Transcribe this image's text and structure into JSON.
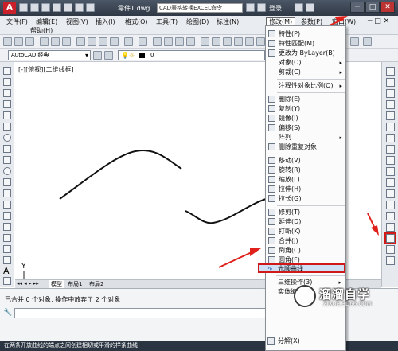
{
  "title_bar": {
    "doc_title": "零件1.dwg",
    "search_text": "CAD表格转换EXCEL命令",
    "user_label": "登录",
    "minimize": "─",
    "maximize": "□",
    "close": "✕"
  },
  "menu_bar": {
    "items": [
      "文件(F)",
      "编辑(E)",
      "视图(V)",
      "插入(I)",
      "格式(O)",
      "工具(T)",
      "绘图(D)",
      "标注(N)",
      "修改(M)",
      "参数(P)",
      "窗口(W)"
    ],
    "help": "帮助(H)",
    "active": "修改(M)"
  },
  "toolbar": {
    "workspace": "AutoCAD 经典",
    "layer_value": "0"
  },
  "canvas": {
    "view_label": "[-][俯视][二维线框]",
    "ucs_y": "Y",
    "ucs_x": "X"
  },
  "tabs": {
    "model": "模型",
    "layout1": "布局1",
    "layout2": "布局2"
  },
  "command": {
    "line1": "已合并 0 个对象, 操作中放弃了 2 个对象",
    "status": "在两条开放曲线的端点之间创建相切或平滑的样条曲线"
  },
  "dropdown": {
    "items": [
      {
        "label": "特性(P)",
        "arrow": ""
      },
      {
        "label": "特性匹配(M)",
        "arrow": ""
      },
      {
        "label": "更改为 ByLayer(B)",
        "arrow": ""
      },
      {
        "label": "对象(O)",
        "arrow": "▸"
      },
      {
        "label": "剪裁(C)",
        "arrow": "▸"
      },
      {
        "label": "注释性对象比例(O)",
        "arrow": "▸"
      },
      {
        "label": "删除(E)",
        "arrow": ""
      },
      {
        "label": "复制(Y)",
        "arrow": ""
      },
      {
        "label": "镜像(I)",
        "arrow": ""
      },
      {
        "label": "偏移(S)",
        "arrow": ""
      },
      {
        "label": "阵列",
        "arrow": "▸"
      },
      {
        "label": "删除重复对象",
        "arrow": ""
      },
      {
        "label": "移动(V)",
        "arrow": ""
      },
      {
        "label": "旋转(R)",
        "arrow": ""
      },
      {
        "label": "缩放(L)",
        "arrow": ""
      },
      {
        "label": "拉伸(H)",
        "arrow": ""
      },
      {
        "label": "拉长(G)",
        "arrow": ""
      },
      {
        "label": "修剪(T)",
        "arrow": ""
      },
      {
        "label": "延伸(D)",
        "arrow": ""
      },
      {
        "label": "打断(K)",
        "arrow": ""
      },
      {
        "label": "合并(J)",
        "arrow": ""
      },
      {
        "label": "倒角(C)",
        "arrow": ""
      },
      {
        "label": "圆角(F)",
        "arrow": ""
      },
      {
        "label": "光顺曲线",
        "arrow": ""
      },
      {
        "label": "三维操作(3)",
        "arrow": "▸"
      },
      {
        "label": "实体编辑(N)",
        "arrow": "▸"
      },
      {
        "label": "分解(X)",
        "arrow": ""
      }
    ]
  },
  "watermark": {
    "name": "溜溜自学",
    "url": "ZIXUE.3D66.COM"
  },
  "colors": {
    "highlight_border": "#d01818",
    "arrow": "#e0201a"
  }
}
